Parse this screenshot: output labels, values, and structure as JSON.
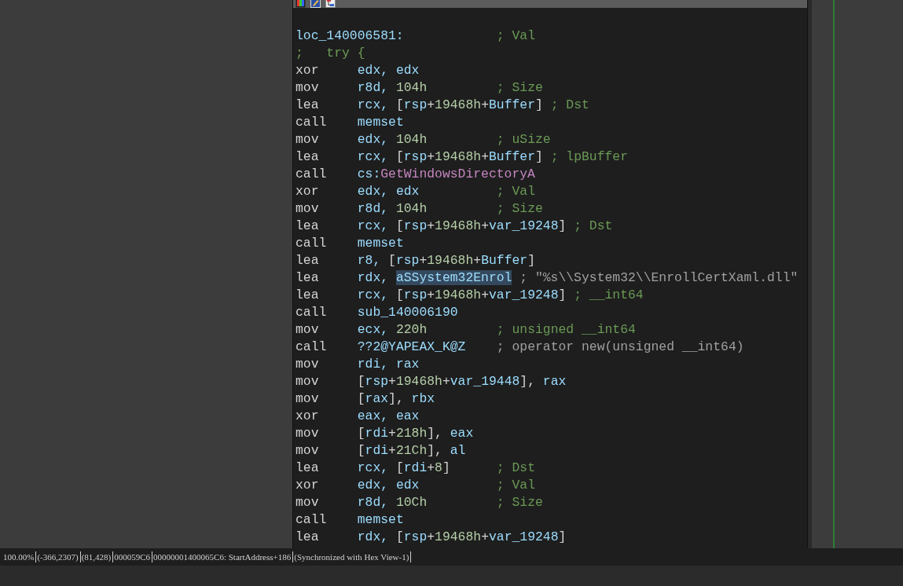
{
  "graph_node": {
    "lines": [
      {
        "kind": "label",
        "text": "loc_140006581:",
        "comment": {
          "text": "; Val",
          "kind": "user"
        }
      },
      {
        "kind": "comment_line",
        "text": ";   try {"
      },
      {
        "kind": "insn",
        "mnemonic": "xor",
        "operand": [
          {
            "t": "edx, edx",
            "kind": "reg"
          }
        ]
      },
      {
        "kind": "insn",
        "mnemonic": "mov",
        "operand": [
          {
            "t": "r8d, ",
            "kind": "reg"
          },
          {
            "t": "104h",
            "kind": "num"
          }
        ],
        "comment": {
          "text": "; Size",
          "kind": "user"
        }
      },
      {
        "kind": "insn",
        "mnemonic": "lea",
        "operand": [
          {
            "t": "rcx, ",
            "kind": "reg"
          },
          {
            "t": "[",
            "kind": "plain"
          },
          {
            "t": "rsp",
            "kind": "reg"
          },
          {
            "t": "+",
            "kind": "plain"
          },
          {
            "t": "19468h",
            "kind": "num"
          },
          {
            "t": "+",
            "kind": "plain"
          },
          {
            "t": "Buffer",
            "kind": "reg"
          },
          {
            "t": "]",
            "kind": "plain"
          }
        ],
        "comment": {
          "text": "; Dst",
          "kind": "user"
        }
      },
      {
        "kind": "insn",
        "mnemonic": "call",
        "operand": [
          {
            "t": "memset",
            "kind": "reg"
          }
        ]
      },
      {
        "kind": "insn",
        "mnemonic": "mov",
        "operand": [
          {
            "t": "edx, ",
            "kind": "reg"
          },
          {
            "t": "104h",
            "kind": "num"
          }
        ],
        "comment": {
          "text": "; uSize",
          "kind": "user"
        }
      },
      {
        "kind": "insn",
        "mnemonic": "lea",
        "operand": [
          {
            "t": "rcx, ",
            "kind": "reg"
          },
          {
            "t": "[",
            "kind": "plain"
          },
          {
            "t": "rsp",
            "kind": "reg"
          },
          {
            "t": "+",
            "kind": "plain"
          },
          {
            "t": "19468h",
            "kind": "num"
          },
          {
            "t": "+",
            "kind": "plain"
          },
          {
            "t": "Buffer",
            "kind": "reg"
          },
          {
            "t": "]",
            "kind": "plain"
          }
        ],
        "comment": {
          "text": "; lpBuffer",
          "kind": "user"
        }
      },
      {
        "kind": "insn",
        "mnemonic": "call",
        "operand": [
          {
            "t": "cs:",
            "kind": "reg"
          },
          {
            "t": "GetWindowsDirectoryA",
            "kind": "import"
          }
        ]
      },
      {
        "kind": "insn",
        "mnemonic": "xor",
        "operand": [
          {
            "t": "edx, edx",
            "kind": "reg"
          }
        ],
        "comment": {
          "text": "; Val",
          "kind": "user"
        }
      },
      {
        "kind": "insn",
        "mnemonic": "mov",
        "operand": [
          {
            "t": "r8d, ",
            "kind": "reg"
          },
          {
            "t": "104h",
            "kind": "num"
          }
        ],
        "comment": {
          "text": "; Size",
          "kind": "user"
        }
      },
      {
        "kind": "insn",
        "mnemonic": "lea",
        "operand": [
          {
            "t": "rcx, ",
            "kind": "reg"
          },
          {
            "t": "[",
            "kind": "plain"
          },
          {
            "t": "rsp",
            "kind": "reg"
          },
          {
            "t": "+",
            "kind": "plain"
          },
          {
            "t": "19468h",
            "kind": "num"
          },
          {
            "t": "+",
            "kind": "plain"
          },
          {
            "t": "var_19248",
            "kind": "reg"
          },
          {
            "t": "]",
            "kind": "plain"
          }
        ],
        "comment": {
          "text": "; Dst",
          "kind": "user"
        }
      },
      {
        "kind": "insn",
        "mnemonic": "call",
        "operand": [
          {
            "t": "memset",
            "kind": "reg"
          }
        ]
      },
      {
        "kind": "insn",
        "mnemonic": "lea",
        "operand": [
          {
            "t": "r8, ",
            "kind": "reg"
          },
          {
            "t": "[",
            "kind": "plain"
          },
          {
            "t": "rsp",
            "kind": "reg"
          },
          {
            "t": "+",
            "kind": "plain"
          },
          {
            "t": "19468h",
            "kind": "num"
          },
          {
            "t": "+",
            "kind": "plain"
          },
          {
            "t": "Buffer",
            "kind": "reg"
          },
          {
            "t": "]",
            "kind": "plain"
          }
        ]
      },
      {
        "kind": "insn",
        "mnemonic": "lea",
        "operand": [
          {
            "t": "rdx, ",
            "kind": "reg"
          },
          {
            "t": "aSSystem32Enrol",
            "kind": "reg",
            "highlighted": true
          }
        ],
        "comment": {
          "text": "; \"%s\\\\System32\\\\EnrollCertXaml.dll\"",
          "kind": "auto"
        }
      },
      {
        "kind": "insn",
        "mnemonic": "lea",
        "operand": [
          {
            "t": "rcx, ",
            "kind": "reg"
          },
          {
            "t": "[",
            "kind": "plain"
          },
          {
            "t": "rsp",
            "kind": "reg"
          },
          {
            "t": "+",
            "kind": "plain"
          },
          {
            "t": "19468h",
            "kind": "num"
          },
          {
            "t": "+",
            "kind": "plain"
          },
          {
            "t": "var_19248",
            "kind": "reg"
          },
          {
            "t": "]",
            "kind": "plain"
          }
        ],
        "comment": {
          "text": "; __int64",
          "kind": "user"
        }
      },
      {
        "kind": "insn",
        "mnemonic": "call",
        "operand": [
          {
            "t": "sub_140006190",
            "kind": "reg"
          }
        ]
      },
      {
        "kind": "insn",
        "mnemonic": "mov",
        "operand": [
          {
            "t": "ecx, ",
            "kind": "reg"
          },
          {
            "t": "220h",
            "kind": "num"
          }
        ],
        "comment": {
          "text": "; unsigned __int64",
          "kind": "user"
        }
      },
      {
        "kind": "insn",
        "mnemonic": "call",
        "operand": [
          {
            "t": "??2@YAPEAX_K@Z",
            "kind": "reg"
          }
        ],
        "comment": {
          "text": "; operator new(unsigned __int64)",
          "kind": "auto"
        }
      },
      {
        "kind": "insn",
        "mnemonic": "mov",
        "operand": [
          {
            "t": "rdi, rax",
            "kind": "reg"
          }
        ]
      },
      {
        "kind": "insn",
        "mnemonic": "mov",
        "operand": [
          {
            "t": "[",
            "kind": "plain"
          },
          {
            "t": "rsp",
            "kind": "reg"
          },
          {
            "t": "+",
            "kind": "plain"
          },
          {
            "t": "19468h",
            "kind": "num"
          },
          {
            "t": "+",
            "kind": "plain"
          },
          {
            "t": "var_19448",
            "kind": "reg"
          },
          {
            "t": "], ",
            "kind": "plain"
          },
          {
            "t": "rax",
            "kind": "reg"
          }
        ]
      },
      {
        "kind": "insn",
        "mnemonic": "mov",
        "operand": [
          {
            "t": "[",
            "kind": "plain"
          },
          {
            "t": "rax",
            "kind": "reg"
          },
          {
            "t": "], ",
            "kind": "plain"
          },
          {
            "t": "rbx",
            "kind": "reg"
          }
        ]
      },
      {
        "kind": "insn",
        "mnemonic": "xor",
        "operand": [
          {
            "t": "eax, eax",
            "kind": "reg"
          }
        ]
      },
      {
        "kind": "insn",
        "mnemonic": "mov",
        "operand": [
          {
            "t": "[",
            "kind": "plain"
          },
          {
            "t": "rdi",
            "kind": "reg"
          },
          {
            "t": "+",
            "kind": "plain"
          },
          {
            "t": "218h",
            "kind": "num"
          },
          {
            "t": "], ",
            "kind": "plain"
          },
          {
            "t": "eax",
            "kind": "reg"
          }
        ]
      },
      {
        "kind": "insn",
        "mnemonic": "mov",
        "operand": [
          {
            "t": "[",
            "kind": "plain"
          },
          {
            "t": "rdi",
            "kind": "reg"
          },
          {
            "t": "+",
            "kind": "plain"
          },
          {
            "t": "21Ch",
            "kind": "num"
          },
          {
            "t": "], ",
            "kind": "plain"
          },
          {
            "t": "al",
            "kind": "reg"
          }
        ]
      },
      {
        "kind": "insn",
        "mnemonic": "lea",
        "operand": [
          {
            "t": "rcx, ",
            "kind": "reg"
          },
          {
            "t": "[",
            "kind": "plain"
          },
          {
            "t": "rdi",
            "kind": "reg"
          },
          {
            "t": "+",
            "kind": "plain"
          },
          {
            "t": "8",
            "kind": "num"
          },
          {
            "t": "]",
            "kind": "plain"
          }
        ],
        "comment": {
          "text": "; Dst",
          "kind": "user"
        }
      },
      {
        "kind": "insn",
        "mnemonic": "xor",
        "operand": [
          {
            "t": "edx, edx",
            "kind": "reg"
          }
        ],
        "comment": {
          "text": "; Val",
          "kind": "user"
        }
      },
      {
        "kind": "insn",
        "mnemonic": "mov",
        "operand": [
          {
            "t": "r8d, ",
            "kind": "reg"
          },
          {
            "t": "10Ch",
            "kind": "num"
          }
        ],
        "comment": {
          "text": "; Size",
          "kind": "user"
        }
      },
      {
        "kind": "insn",
        "mnemonic": "call",
        "operand": [
          {
            "t": "memset",
            "kind": "reg"
          }
        ]
      },
      {
        "kind": "insn",
        "mnemonic": "lea",
        "operand": [
          {
            "t": "rdx, ",
            "kind": "reg"
          },
          {
            "t": "[",
            "kind": "plain"
          },
          {
            "t": "rsp",
            "kind": "reg"
          },
          {
            "t": "+",
            "kind": "plain"
          },
          {
            "t": "19468h",
            "kind": "num"
          },
          {
            "t": "+",
            "kind": "plain"
          },
          {
            "t": "var_19248",
            "kind": "reg"
          },
          {
            "t": "]",
            "kind": "plain"
          }
        ]
      }
    ]
  },
  "status_bar": [
    "100.00%",
    "(-366,2307)",
    "(81,428)",
    "000059C6",
    "00000001400065C6: StartAddress+186",
    "(Synchronized with Hex View-1)"
  ]
}
